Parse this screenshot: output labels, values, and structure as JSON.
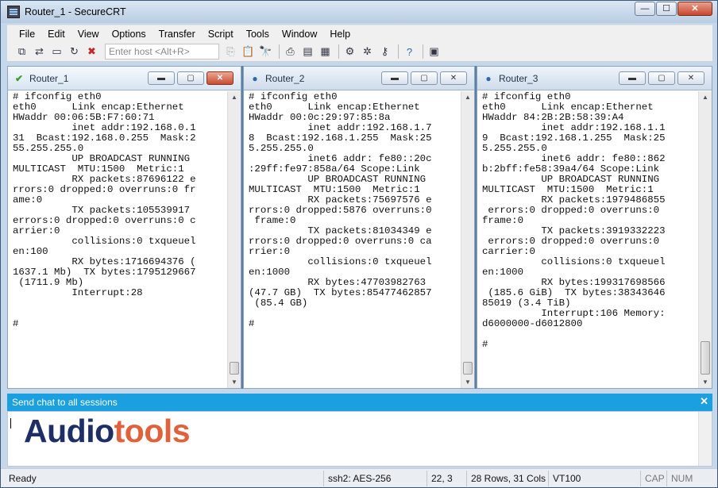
{
  "window": {
    "title": "Router_1 - SecureCRT",
    "minimize": "—",
    "maximize": "☐",
    "close": "✕"
  },
  "menu": [
    "File",
    "Edit",
    "View",
    "Options",
    "Transfer",
    "Script",
    "Tools",
    "Window",
    "Help"
  ],
  "toolbar": {
    "host_placeholder": "Enter host <Alt+R>"
  },
  "sessions": [
    {
      "title": "Router_1",
      "status_icon": "check-icon",
      "active": true,
      "output": "# ifconfig eth0\neth0      Link encap:Ethernet\nHWaddr 00:06:5B:F7:60:71\n          inet addr:192.168.0.1\n31  Bcast:192.168.0.255  Mask:2\n55.255.255.0\n          UP BROADCAST RUNNING\nMULTICAST  MTU:1500  Metric:1\n          RX packets:87696122 e\nrrors:0 dropped:0 overruns:0 fr\name:0\n          TX packets:105539917\nerrors:0 dropped:0 overruns:0 c\narrier:0\n          collisions:0 txqueuel\nen:100\n          RX bytes:1716694376 (\n1637.1 Mb)  TX bytes:1795129667\n (1711.9 Mb)\n          Interrupt:28\n\n\n#"
    },
    {
      "title": "Router_2",
      "status_icon": "info-icon",
      "active": false,
      "output": "# ifconfig eth0\neth0      Link encap:Ethernet\nHWaddr 00:0c:29:97:85:8a\n          inet addr:192.168.1.7\n8  Bcast:192.168.1.255  Mask:25\n5.255.255.0\n          inet6 addr: fe80::20c\n:29ff:fe97:858a/64 Scope:Link\n          UP BROADCAST RUNNING\nMULTICAST  MTU:1500  Metric:1\n          RX packets:75697576 e\nrrors:0 dropped:5876 overruns:0\n frame:0\n          TX packets:81034349 e\nrrors:0 dropped:0 overruns:0 ca\nrrier:0\n          collisions:0 txqueuel\nen:1000\n          RX bytes:47703982763\n(47.7 GB)  TX bytes:85477462857\n (85.4 GB)\n\n#"
    },
    {
      "title": "Router_3",
      "status_icon": "info-icon",
      "active": false,
      "output": "# ifconfig eth0\neth0      Link encap:Ethernet\nHWaddr 84:2B:2B:58:39:A4\n          inet addr:192.168.1.1\n9  Bcast:192.168.1.255  Mask:25\n5.255.255.0\n          inet6 addr: fe80::862\nb:2bff:fe58:39a4/64 Scope:Link\n          UP BROADCAST RUNNING\nMULTICAST  MTU:1500  Metric:1\n          RX packets:1979486855\n errors:0 dropped:0 overruns:0\nframe:0\n          TX packets:3919332223\n errors:0 dropped:0 overruns:0\ncarrier:0\n          collisions:0 txqueuel\nen:1000\n          RX bytes:199317698566\n (185.6 GiB)  TX bytes:38343646\n85019 (3.4 TiB)\n          Interrupt:106 Memory:\nd6000000-d6012800\n\n#"
    }
  ],
  "chat": {
    "title": "Send chat to all sessions",
    "close": "✕",
    "logo_a": "Audio",
    "logo_b": "tools"
  },
  "status": {
    "ready": "Ready",
    "cipher": "ssh2: AES-256",
    "cursor": "22,  3",
    "size": "28 Rows, 31 Cols",
    "terminal": "VT100",
    "caps": "CAP",
    "num": "NUM"
  }
}
